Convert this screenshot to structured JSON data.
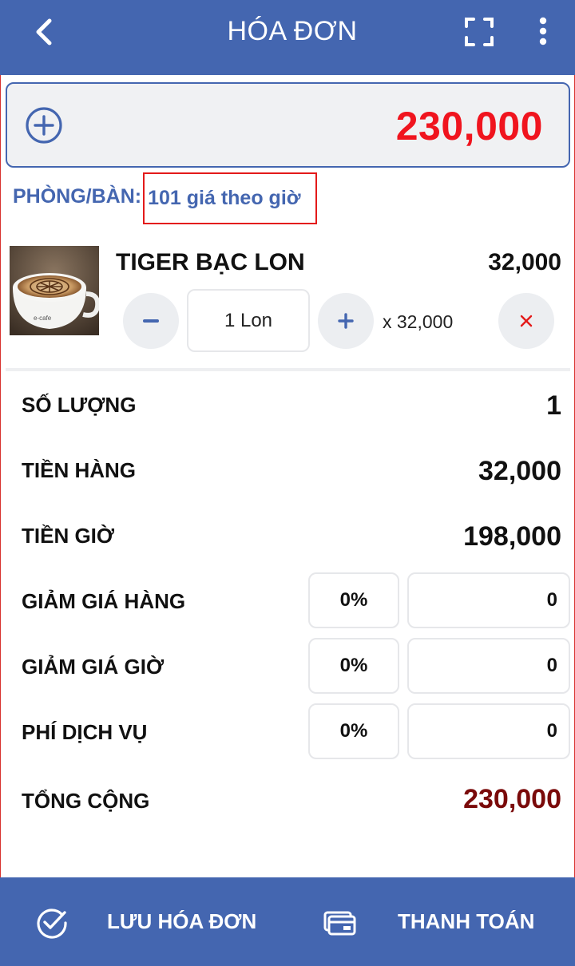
{
  "header": {
    "title": "HÓA ĐƠN",
    "back_icon": "arrow-left-icon",
    "expand_icon": "fullscreen-icon",
    "more_icon": "more-vertical-icon"
  },
  "total_box": {
    "amount": "230,000",
    "add_icon": "plus-circle-icon"
  },
  "room": {
    "label": "PHÒNG/BÀN:",
    "value": "101 giá theo giờ"
  },
  "items": [
    {
      "name": "TIGER BẠC LON",
      "price": "32,000",
      "quantity": "1 Lon",
      "unit_price": "x 32,000",
      "minus_label": "−",
      "plus_label": "+",
      "remove_label": "×",
      "image": "coffee-cup-image"
    }
  ],
  "summary": {
    "quantity": {
      "label": "SỐ LƯỢNG",
      "value": "1"
    },
    "goods_total": {
      "label": "TIỀN HÀNG",
      "value": "32,000"
    },
    "time_total": {
      "label": "TIỀN GIỜ",
      "value": "198,000"
    },
    "goods_discount": {
      "label": "GIẢM GIÁ HÀNG",
      "percent": "0%",
      "amount": "0"
    },
    "time_discount": {
      "label": "GIẢM GIÁ GIỜ",
      "percent": "0%",
      "amount": "0"
    },
    "service_fee": {
      "label": "PHÍ DỊCH VỤ",
      "percent": "0%",
      "amount": "0"
    },
    "grand_total": {
      "label": "TỔNG CỘNG",
      "value": "230,000"
    }
  },
  "footer": {
    "save_label": "LƯU HÓA ĐƠN",
    "pay_label": "THANH TOÁN",
    "save_icon": "check-circle-icon",
    "pay_icon": "payment-card-icon"
  },
  "colors": {
    "primary": "#4466b0",
    "total_red": "#f0141e",
    "grand_total": "#7a0a0a",
    "highlight_border": "#e31a1a"
  }
}
